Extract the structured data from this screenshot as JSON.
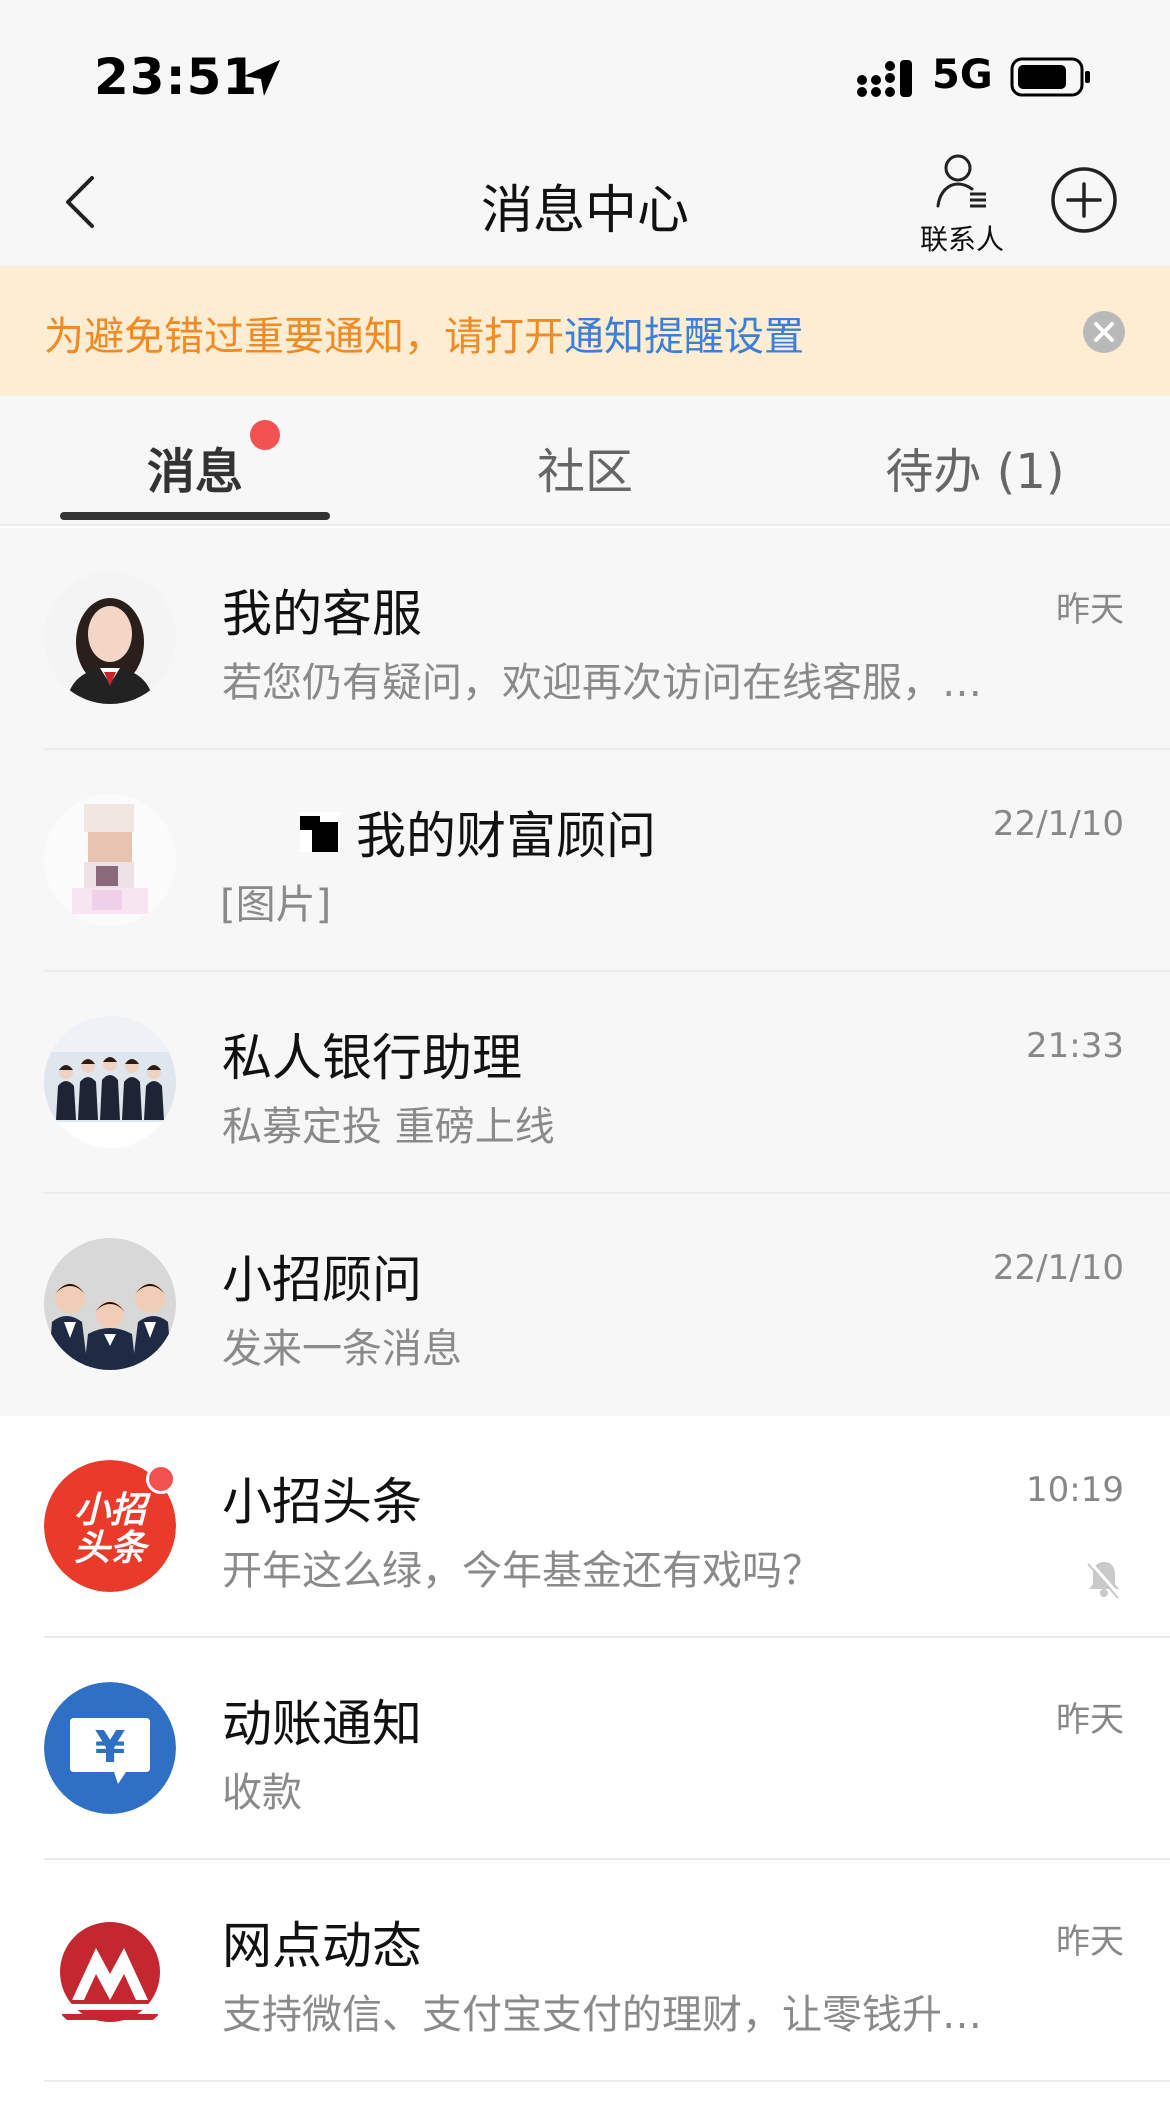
{
  "status_bar": {
    "time": "23:51",
    "network": "5G"
  },
  "nav": {
    "title": "消息中心",
    "contacts_label": "联系人"
  },
  "notice": {
    "text": "为避免错过重要通知，请打开",
    "link": "通知提醒设置"
  },
  "tabs": [
    {
      "label": "消息",
      "active": true,
      "has_dot": true
    },
    {
      "label": "社区",
      "active": false
    },
    {
      "label": "待办 (1)",
      "active": false
    }
  ],
  "messages": [
    {
      "title": "我的客服",
      "preview": "若您仍有疑问，欢迎再次访问在线客服，…",
      "time": "昨天",
      "avatar": "customer-service-avatar"
    },
    {
      "title": "我的财富顾问",
      "preview": "[图片]",
      "time": "22/1/10",
      "avatar": "wealth-advisor-avatar"
    },
    {
      "title": "私人银行助理",
      "preview": "私募定投 重磅上线",
      "time": "21:33",
      "avatar": "private-bank-assistant-avatar"
    },
    {
      "title": "小招顾问",
      "preview": "发来一条消息",
      "time": "22/1/10",
      "avatar": "advisor-team-avatar"
    },
    {
      "title": "小招头条",
      "preview": "开年这么绿，今年基金还有戏吗？",
      "time": "10:19",
      "avatar": "headline-logo",
      "avatar_text_1": "小招",
      "avatar_text_2": "头条",
      "unread": true,
      "muted": true
    },
    {
      "title": "动账通知",
      "preview": "收款",
      "time": "昨天",
      "avatar": "yuan-chat-icon",
      "avatar_text": "¥"
    },
    {
      "title": "网点动态",
      "preview": "支持微信、支付宝支付的理财，让零钱升…",
      "time": "昨天",
      "avatar": "cmb-logo"
    }
  ],
  "colors": {
    "notice_bg": "#fdedd3",
    "notice_text": "#f08a24",
    "link": "#3d7fd6",
    "badge": "#f25252",
    "headline_red": "#ea3a2a",
    "yuan_blue": "#2f6fc4",
    "cmb_red": "#c4272f"
  }
}
